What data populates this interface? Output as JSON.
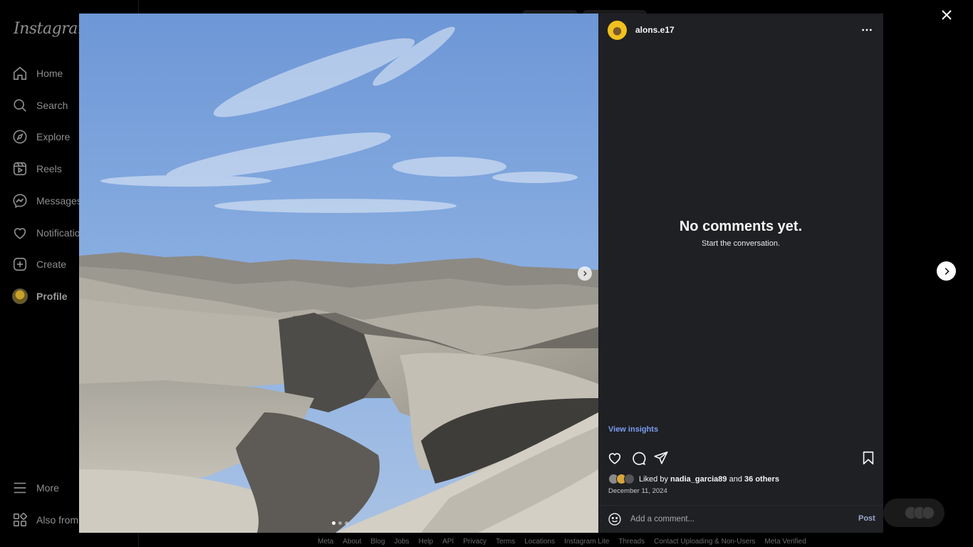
{
  "app": {
    "logo": "Instagram"
  },
  "sidebar": {
    "items": [
      {
        "label": "Home",
        "icon": "home-icon"
      },
      {
        "label": "Search",
        "icon": "search-icon"
      },
      {
        "label": "Explore",
        "icon": "compass-icon"
      },
      {
        "label": "Reels",
        "icon": "reels-icon"
      },
      {
        "label": "Messages",
        "icon": "messenger-icon"
      },
      {
        "label": "Notifications",
        "icon": "heart-icon"
      },
      {
        "label": "Create",
        "icon": "plus-square-icon"
      },
      {
        "label": "Profile",
        "icon": "avatar"
      }
    ],
    "more_label": "More",
    "also_from_label": "Also from Meta"
  },
  "post": {
    "username": "alons.e17",
    "empty_title": "No comments yet.",
    "empty_subtitle": "Start the conversation.",
    "view_insights": "View insights",
    "liked_by_prefix": "Liked by",
    "liked_by_user": "nadia_garcia89",
    "liked_by_and": "and",
    "liked_by_others": "36 others",
    "date": "December 11, 2024",
    "comment_placeholder": "Add a comment...",
    "post_label": "Post",
    "carousel": {
      "count": 3,
      "active_index": 1
    }
  },
  "footer": {
    "links": [
      "Meta",
      "About",
      "Blog",
      "Jobs",
      "Help",
      "API",
      "Privacy",
      "Terms",
      "Locations",
      "Instagram Lite",
      "Threads",
      "Contact Uploading & Non-Users",
      "Meta Verified"
    ]
  },
  "colors": {
    "panel_bg": "#1f2024",
    "link_blue": "#7a9cf0",
    "overlay_bg": "#000000"
  }
}
